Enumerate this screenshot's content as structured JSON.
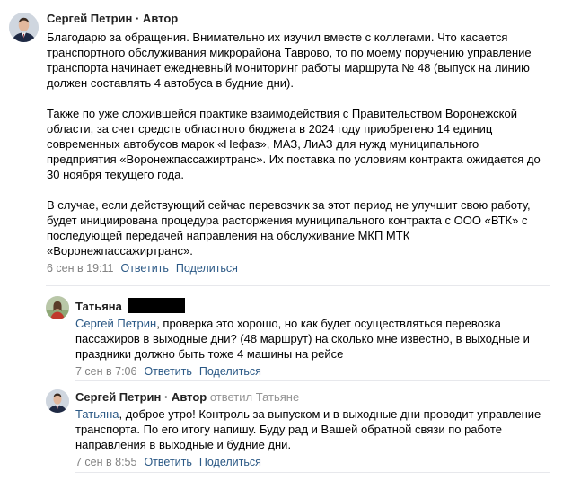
{
  "comments": [
    {
      "author": "Сергей Петрин",
      "role_suffix": " · Автор",
      "paragraphs": [
        "Благодарю за обращения. Внимательно их изучил вместе с коллегами. Что касается транспортного обслуживания микрорайона Таврово, то по моему поручению управление транспорта начинает ежедневный мониторинг работы маршрута № 48 (выпуск на линию должен составлять 4 автобуса в будние дни).",
        "Также по уже сложившейся практике взаимодействия с Правительством Воронежской области, за счет средств областного бюджета в 2024 году приобретено 14 единиц современных автобусов марок «Нефаз», МАЗ, ЛиАЗ для нужд муниципального предприятия «Воронежпассажиртранс». Их поставка по условиям контракта ожидается до 30 ноября текущего года.",
        "В случае, если действующий сейчас перевозчик за этот период не улучшит свою работу, будет инициирована процедура расторжения муниципального контракта с ООО «ВТК» с последующей передачей направления на обслуживание МКП МТК «Воронежпассажиртранс»."
      ],
      "date": "6 сен в 19:11",
      "reply_label": "Ответить",
      "share_label": "Поделиться"
    },
    {
      "author": "Татьяна",
      "mention": "Сергей Петрин",
      "text": ", проверка это хорошо, но как будет осуществляться перевозка пассажиров в выходные дни? (48 маршрут) на сколько мне известно, в выходные и праздники должно быть тоже 4 машины на рейсе",
      "date": "7 сен в 7:06",
      "reply_label": "Ответить",
      "share_label": "Поделиться"
    },
    {
      "author": "Сергей Петрин",
      "role_suffix": " · Автор",
      "replied_word": "ответил",
      "replied_to": "Татьяне",
      "mention": "Татьяна",
      "text": ", доброе утро! Контроль за выпуском и в выходные дни проводит управление транспорта. По его итогу напишу. Буду рад и Вашей обратной связи по работе направления в выходные и будние дни.",
      "date": "7 сен в 8:55",
      "reply_label": "Ответить",
      "share_label": "Поделиться"
    }
  ],
  "colors": {
    "link": "#2a5885",
    "meta": "#828282",
    "divider": "#e7e8ec"
  }
}
